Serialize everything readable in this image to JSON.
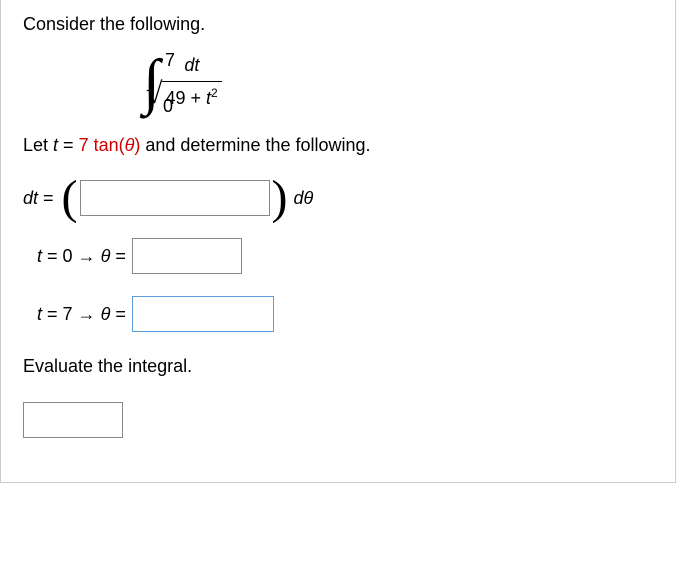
{
  "intro": "Consider the following.",
  "integral": {
    "lower": "0",
    "upper": "7",
    "numerator": "dt",
    "radicand_const": "49",
    "radicand_plus": " + ",
    "radicand_var": "t",
    "radicand_exp": "2"
  },
  "substitution": {
    "prefix": "Let ",
    "t_label": "t",
    "equals": " = ",
    "value_num": "7",
    "value_func": " tan(",
    "theta": "θ",
    "value_close": ")",
    "suffix": " and determine the following."
  },
  "rows": {
    "dt": {
      "lhs_var": "dt",
      "lhs_eq": " = ",
      "after": "dθ"
    },
    "t0": {
      "t_var": "t",
      "eq1": " = ",
      "val": "0",
      "arrow": " → ",
      "theta_var": "θ",
      "eq2": " = "
    },
    "t7": {
      "t_var": "t",
      "eq1": " = ",
      "val": "7",
      "arrow": " → ",
      "theta_var": "θ",
      "eq2": " = "
    }
  },
  "evaluate": "Evaluate the integral.",
  "inputs": {
    "dt_value": "",
    "theta0_value": "",
    "theta7_value": "",
    "final_value": ""
  }
}
